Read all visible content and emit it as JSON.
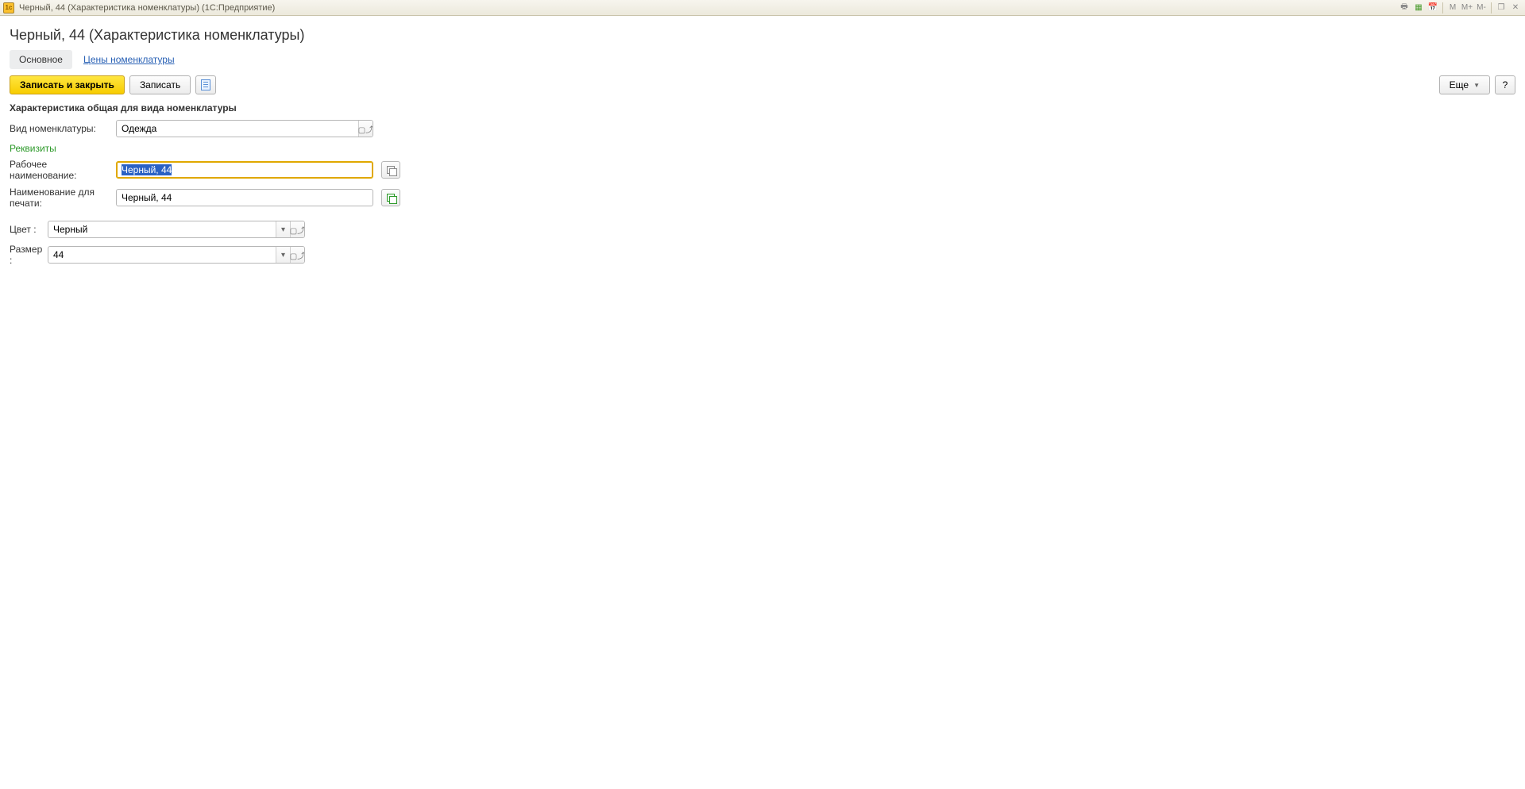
{
  "titlebar": {
    "text": "Черный, 44 (Характеристика номенклатуры)  (1С:Предприятие)",
    "m_labels": [
      "M",
      "M+",
      "M-"
    ]
  },
  "page_title": "Черный, 44 (Характеристика номенклатуры)",
  "tabs": {
    "main": "Основное",
    "prices": "Цены номенклатуры"
  },
  "toolbar": {
    "save_close": "Записать и закрыть",
    "save": "Записать",
    "more": "Еще",
    "help": "?"
  },
  "section_heading": "Характеристика общая для вида номенклатуры",
  "green_heading": "Реквизиты",
  "labels": {
    "type": "Вид номенклатуры:",
    "work_name": "Рабочее наименование:",
    "print_name": "Наименование для печати:",
    "color": "Цвет :",
    "size": "Размер :"
  },
  "values": {
    "type": "Одежда",
    "work_name": "Черный, 44",
    "print_name": "Черный, 44",
    "color": "Черный",
    "size": "44"
  }
}
